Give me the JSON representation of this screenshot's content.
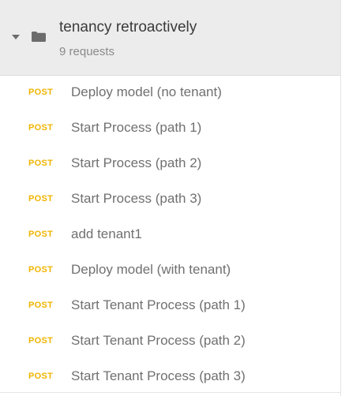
{
  "folder": {
    "title": "tenancy retroactively",
    "subtitle": "9 requests",
    "caret_icon": "caret-down-icon",
    "folder_icon": "folder-icon"
  },
  "requests": [
    {
      "method": "POST",
      "name": "Deploy model (no tenant)"
    },
    {
      "method": "POST",
      "name": "Start Process (path 1)"
    },
    {
      "method": "POST",
      "name": "Start Process (path 2)"
    },
    {
      "method": "POST",
      "name": "Start Process (path 3)"
    },
    {
      "method": "POST",
      "name": "add tenant1"
    },
    {
      "method": "POST",
      "name": "Deploy model (with tenant)"
    },
    {
      "method": "POST",
      "name": "Start Tenant Process (path 1)"
    },
    {
      "method": "POST",
      "name": "Start Tenant Process (path 2)"
    },
    {
      "method": "POST",
      "name": "Start Tenant Process (path 3)"
    }
  ],
  "colors": {
    "post_method": "#f0b400",
    "header_bg": "#ececec"
  }
}
